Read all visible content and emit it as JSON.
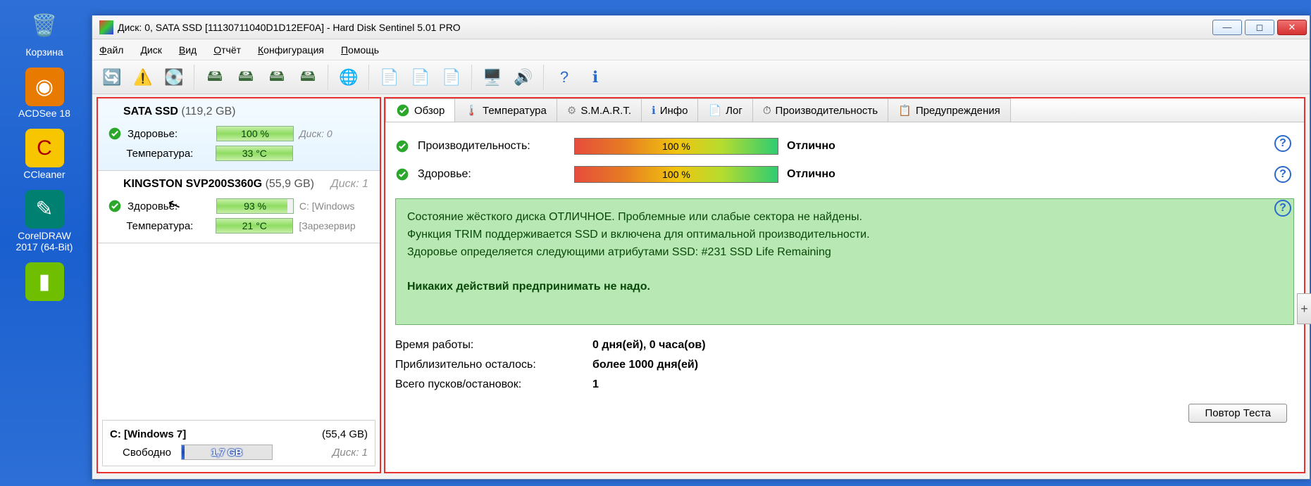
{
  "desktop": {
    "icons": [
      {
        "label": "Корзина",
        "glyph": "🗑"
      },
      {
        "label": "ACDSee 18",
        "glyph": "◎"
      },
      {
        "label": "CCleaner",
        "glyph": "✔"
      },
      {
        "label": "CorelDRAW 2017 (64-Bit)",
        "glyph": "❍"
      },
      {
        "label": "",
        "glyph": "▮"
      }
    ]
  },
  "window": {
    "title": "Диск: 0, SATA SSD [11130711040D1D12EF0A]  -  Hard Disk Sentinel 5.01 PRO"
  },
  "menu": [
    "Файл",
    "Диск",
    "Вид",
    "Отчёт",
    "Конфигурация",
    "Помощь"
  ],
  "left": {
    "disk0": {
      "name": "SATA SSD",
      "cap": "(119,2 GB)",
      "disklabel": "Диск: 0",
      "health_label": "Здоровье:",
      "health_val": "100 %",
      "temp_label": "Температура:",
      "temp_val": "33 °C"
    },
    "disk1": {
      "name": "KINGSTON SVP200S360G",
      "cap": "(55,9 GB)",
      "disklabel": "Диск: 1",
      "health_label": "Здоровье:",
      "health_val": "93 %",
      "health_after": "C: [Windows",
      "temp_label": "Температура:",
      "temp_val": "21 °C",
      "temp_after": "[Зарезервир"
    },
    "vol": {
      "name": "C: [Windows 7]",
      "cap": "(55,4 GB)",
      "free_label": "Свободно",
      "free_val": "1,7 GB",
      "disklabel": "Диск: 1"
    }
  },
  "tabs": {
    "overview": "Обзор",
    "temp": "Температура",
    "smart": "S.M.A.R.T.",
    "info": "Инфо",
    "log": "Лог",
    "perf": "Производительность",
    "warn": "Предупреждения"
  },
  "pane": {
    "perf_label": "Производительность:",
    "perf_val": "100 %",
    "perf_rating": "Отлично",
    "health_label": "Здоровье:",
    "health_val": "100 %",
    "health_rating": "Отлично",
    "info_l1": "Состояние жёсткого диска ОТЛИЧНОЕ. Проблемные или слабые сектора не найдены.",
    "info_l2": "Функция TRIM поддерживается SSD и включена для оптимальной производительности.",
    "info_l3": "Здоровье определяется следующими атрибутами SSD: #231 SSD Life Remaining",
    "info_l4": "Никаких действий предпринимать не надо.",
    "s1l": "Время работы:",
    "s1v": "0 дня(ей), 0 часа(ов)",
    "s2l": "Приблизительно осталось:",
    "s2v": "более 1000 дня(ей)",
    "s3l": "Всего пусков/остановок:",
    "s3v": "1",
    "retest": "Повтор Теста"
  }
}
